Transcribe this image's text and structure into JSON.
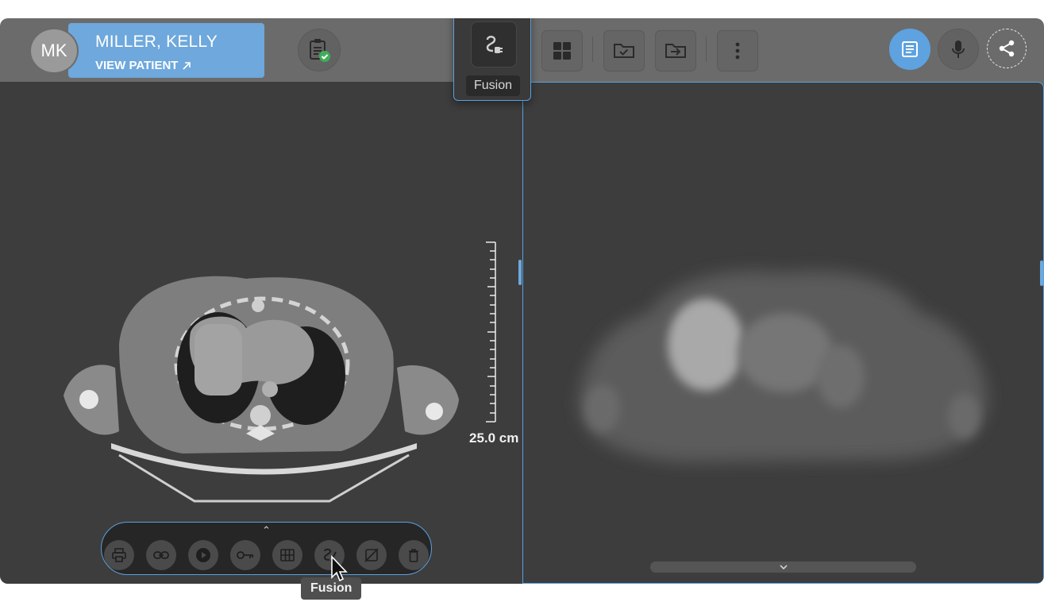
{
  "patient": {
    "initials": "MK",
    "name": "MILLER, KELLY",
    "view_label": "VIEW PATIENT"
  },
  "toolbar_top": {
    "fusion_tooltip": "Fusion",
    "buttons": [
      "clipboard-check-icon",
      "fusion-icon",
      "layout-grid-icon",
      "folder-check-icon",
      "folder-export-icon",
      "more-vertical-icon",
      "report-icon",
      "microphone-icon",
      "share-icon"
    ]
  },
  "viewport_left": {
    "scale_label": "25.0 cm"
  },
  "viewer_toolbar": {
    "buttons": [
      "print-icon",
      "link-icon",
      "play-icon",
      "key-icon",
      "grid-icon",
      "fusion-icon",
      "eye-off-icon",
      "trash-icon"
    ],
    "tooltip": "Fusion"
  },
  "colors": {
    "accent": "#6ea8dc",
    "bar": "#6b6b6b",
    "viewport": "#3d3d3d",
    "success": "#3fae5a"
  }
}
